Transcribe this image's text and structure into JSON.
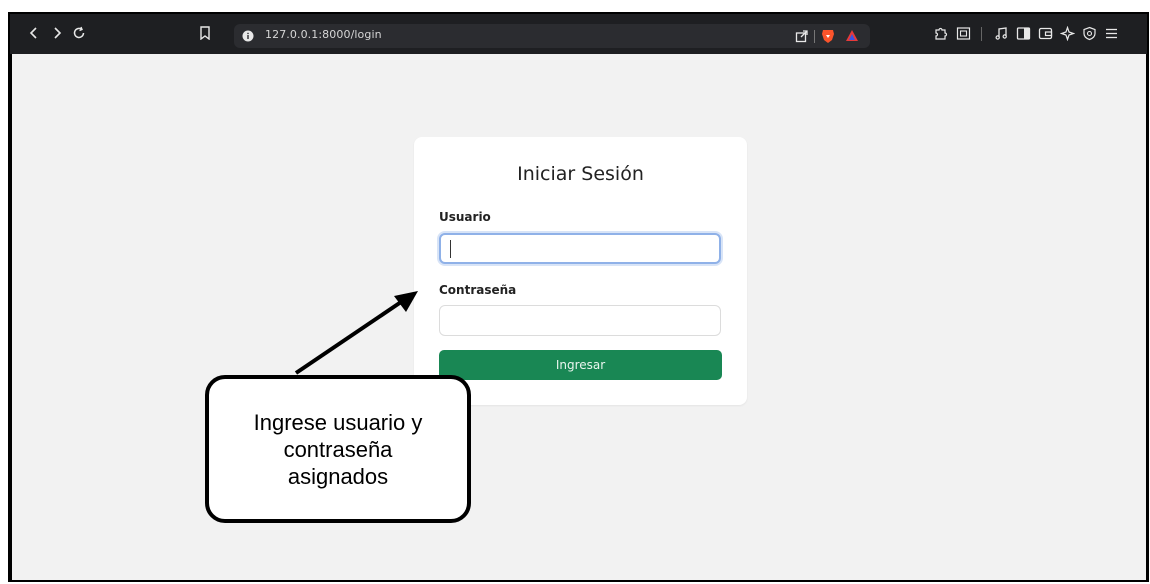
{
  "browser": {
    "url": "127.0.0.1:8000/login",
    "icons": {
      "back": "chevron-left-icon",
      "forward": "chevron-right-icon",
      "reload": "reload-icon",
      "bookmark": "bookmark-icon",
      "site_info": "info-icon",
      "share": "share-icon",
      "brave_shield": "brave-lion-icon",
      "brave_rewards": "brave-rewards-icon",
      "extensions": "puzzle-icon",
      "tab_search": "tab-search-icon",
      "media": "music-icon",
      "sidebar": "sidebar-icon",
      "wallet": "wallet-icon",
      "leo": "leo-ai-icon",
      "vpn": "vpn-shield-icon",
      "menu": "menu-icon"
    }
  },
  "login": {
    "title": "Iniciar Sesión",
    "username_label": "Usuario",
    "username_value": "",
    "password_label": "Contraseña",
    "password_value": "",
    "submit_label": "Ingresar"
  },
  "annotation": {
    "line1": "Ingrese usuario y",
    "line2": "contraseña",
    "line3": "asignados"
  },
  "colors": {
    "toolbar": "#1e1f22",
    "page_background": "#f2f2f2",
    "button": "#198754",
    "focus_ring": "#8fb1e8"
  }
}
